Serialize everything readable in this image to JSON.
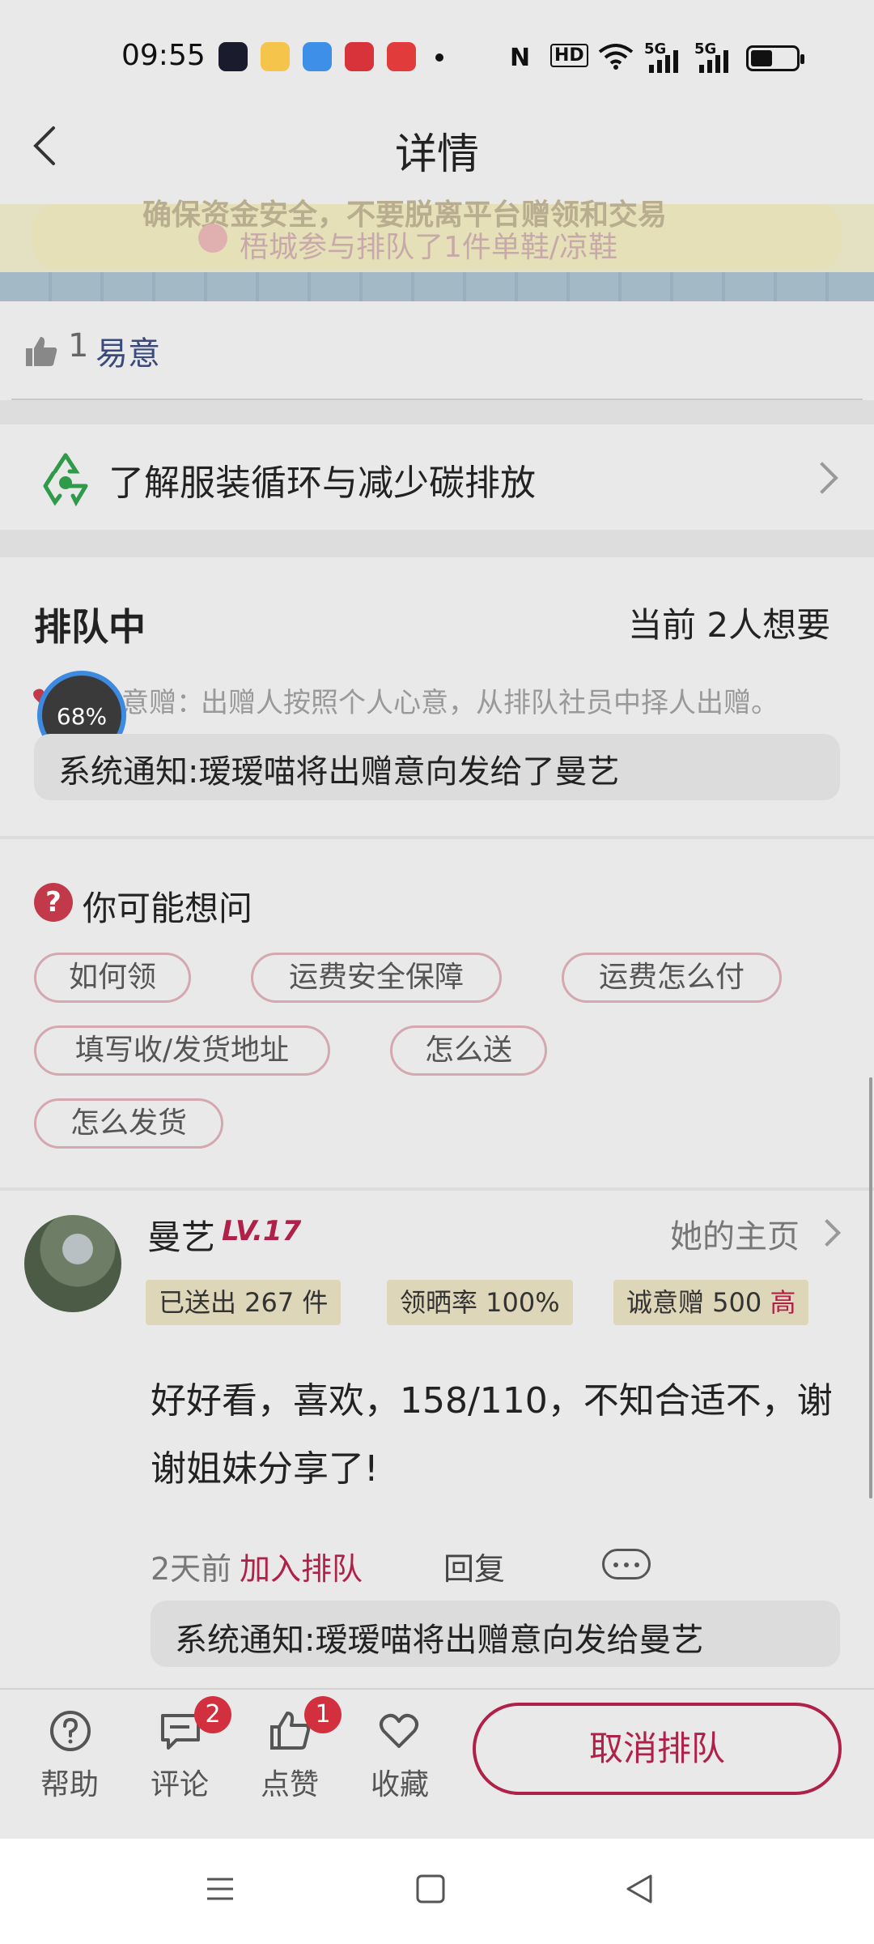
{
  "status_bar": {
    "time": "09:55",
    "nfc": "N",
    "hd": "HD",
    "signal1": "5G",
    "signal2": "5G"
  },
  "header": {
    "title": "详情",
    "back_icon": "chevron-left-icon"
  },
  "banner": {
    "line1": "确保资金安全，不要脱离平台赠领和交易",
    "line2": "梧城参与排队了1件单鞋/凉鞋"
  },
  "likes": {
    "count": "1",
    "name": "易意"
  },
  "recycle": {
    "label": "了解服装循环与减少碳排放"
  },
  "queue": {
    "title": "排队中",
    "count_text": "当前 2人想要",
    "intent_label": "意赠：",
    "intent_desc": "出赠人按照个人心意，从排队社员中择人出赠。",
    "progress": "68%",
    "notice": "系统通知:瑷瑷喵将出赠意向发给了曼艺"
  },
  "faq": {
    "icon": "?",
    "title": "你可能想问",
    "chips": [
      "如何领",
      "运费安全保障",
      "运费怎么付",
      "填写收/发货地址",
      "怎么送",
      "怎么发货"
    ]
  },
  "comment": {
    "user": "曼艺",
    "level": "LV.17",
    "homepage": "她的主页",
    "tags": {
      "sent": "已送出 267 件",
      "rate": "领晒率 100%",
      "sincerity": "诚意赠 500",
      "sincerity_level": "高"
    },
    "text": "好好看，喜欢，158/110，不知合适不，谢谢姐妹分享了!",
    "time": "2天前",
    "action": "加入排队",
    "reply": "回复",
    "notice": "系统通知:瑷瑷喵将出赠意向发给曼艺"
  },
  "bottom_bar": {
    "help": "帮助",
    "comments": "评论",
    "comments_badge": "2",
    "likes": "点赞",
    "likes_badge": "1",
    "favorite": "收藏",
    "cancel_button": "取消排队"
  },
  "colors": {
    "accent": "#b0214a",
    "badge": "#d3303f",
    "progress_ring": "#3d8be0"
  }
}
